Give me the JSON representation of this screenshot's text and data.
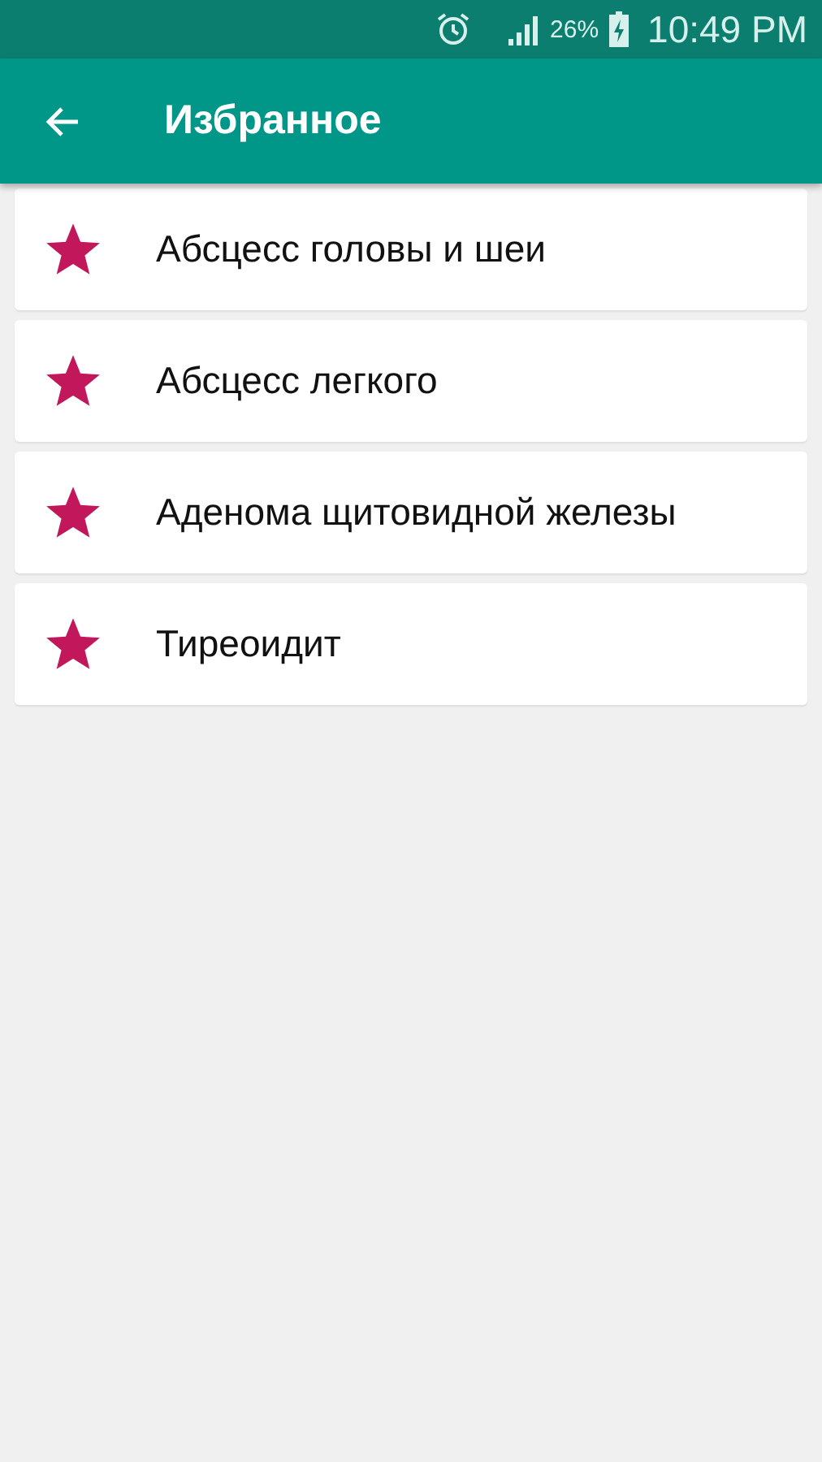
{
  "status_bar": {
    "battery_text": "26%",
    "time": "10:49 PM"
  },
  "app_bar": {
    "title": "Избранное"
  },
  "favorites": [
    {
      "label": "Абсцесс головы и шеи",
      "starred": true
    },
    {
      "label": "Абсцесс легкого",
      "starred": true
    },
    {
      "label": "Аденома щитовидной железы",
      "starred": true
    },
    {
      "label": "Тиреоидит",
      "starred": true
    }
  ]
}
